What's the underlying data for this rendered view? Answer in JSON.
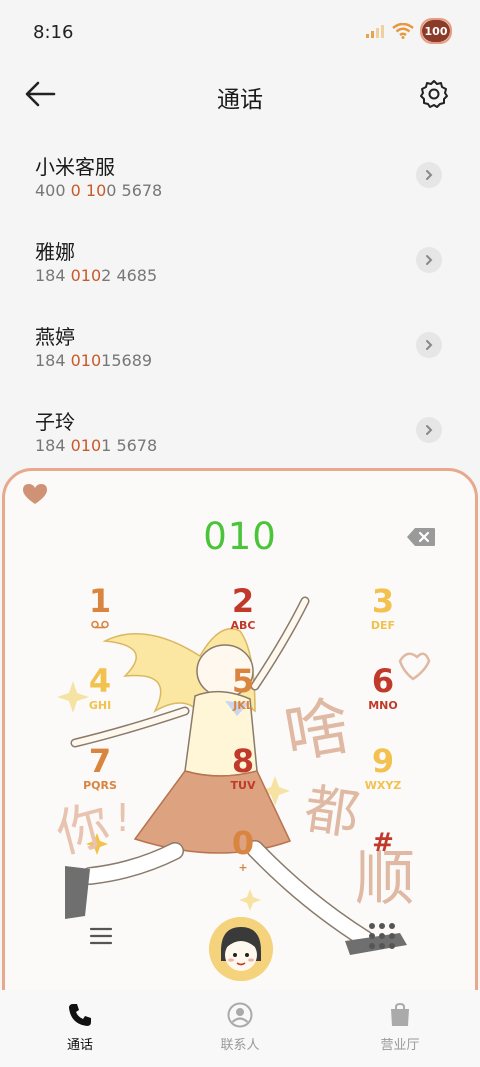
{
  "status_bar": {
    "time": "8:16",
    "battery": "100"
  },
  "header": {
    "title": "通话"
  },
  "contacts": [
    {
      "name": "小米客服",
      "num_pre": "400 ",
      "num_hl": "0 10",
      "num_post": "0 5678"
    },
    {
      "name": "雅娜",
      "num_pre": "184 ",
      "num_hl": "010",
      "num_post": "2 4685"
    },
    {
      "name": "燕婷",
      "num_pre": "184 ",
      "num_hl": "010",
      "num_post": "15689"
    },
    {
      "name": "子玲",
      "num_pre": "184 ",
      "num_hl": "010",
      "num_post": "1 5678"
    }
  ],
  "dialpad": {
    "entered": "010",
    "keys": [
      {
        "digit": "1",
        "letters": "QO",
        "color": "#d9843f"
      },
      {
        "digit": "2",
        "letters": "ABC",
        "color": "#c0392b"
      },
      {
        "digit": "3",
        "letters": "DEF",
        "color": "#f2c14e"
      },
      {
        "digit": "4",
        "letters": "GHI",
        "color": "#f2c14e"
      },
      {
        "digit": "5",
        "letters": "JKL",
        "color": "#d9843f"
      },
      {
        "digit": "6",
        "letters": "MNO",
        "color": "#c0392b"
      },
      {
        "digit": "7",
        "letters": "PQRS",
        "color": "#d9843f"
      },
      {
        "digit": "8",
        "letters": "TUV",
        "color": "#c0392b"
      },
      {
        "digit": "9",
        "letters": "WXYZ",
        "color": "#f2c14e"
      },
      {
        "digit": "0",
        "letters": "+",
        "color": "#d9843f"
      },
      {
        "digit": "#",
        "letters": "",
        "color": "#c0392b"
      }
    ]
  },
  "tabs": [
    {
      "label": "通话",
      "icon": "phone-icon",
      "active": true
    },
    {
      "label": "联系人",
      "icon": "contacts-icon",
      "active": false
    },
    {
      "label": "营业厅",
      "icon": "store-bag-icon",
      "active": false
    }
  ],
  "colors": {
    "accent_green": "#4cc43a",
    "highlight": "#c85a2a",
    "frame": "#e7a98c"
  }
}
